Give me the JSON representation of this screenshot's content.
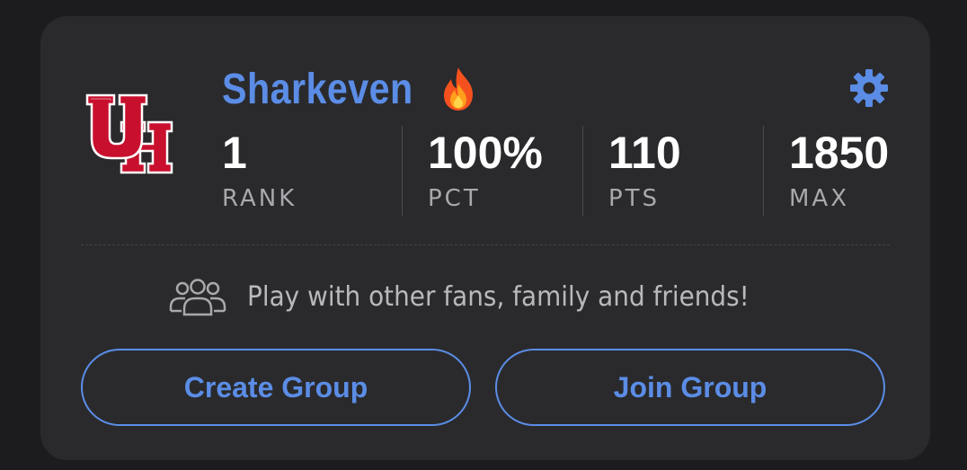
{
  "profile": {
    "username": "Sharkeven",
    "streak_icon": "fire-emoji",
    "team_logo": "UH",
    "logo_color": "#c8102e"
  },
  "stats": [
    {
      "value": "1",
      "label": "RANK"
    },
    {
      "value": "100%",
      "label": "PCT"
    },
    {
      "value": "110",
      "label": "PTS"
    },
    {
      "value": "1850",
      "label": "MAX"
    }
  ],
  "invite": {
    "text": "Play with other fans, family and friends!",
    "icon": "group-icon"
  },
  "actions": {
    "create_label": "Create Group",
    "join_label": "Join Group"
  },
  "colors": {
    "accent": "#5b8de6",
    "card_bg": "#2a2a2d",
    "page_bg": "#1c1c1e"
  }
}
